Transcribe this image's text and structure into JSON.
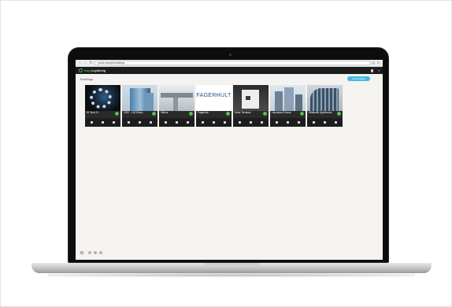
{
  "browser": {
    "url": "portal.example/buildings",
    "url_suffix": ""
  },
  "app": {
    "brand_prefix": "mapp",
    "brand_suffix": "Lightning",
    "user_name": "",
    "accent": "#4bb34f"
  },
  "page": {
    "title": "Buildings",
    "add_button": "Add building"
  },
  "cards": [
    {
      "name": "ID Tech 21",
      "sub": "",
      "photo": "p0"
    },
    {
      "name": "2020 - 100 Shad...",
      "sub": "",
      "photo": "p1"
    },
    {
      "name": "Vilnius",
      "sub": "",
      "photo": "p2"
    },
    {
      "name": "Fagerhult",
      "sub": "",
      "photo": "p3",
      "brand_text": "FAGERHULT"
    },
    {
      "name": "Duke Terraces",
      "sub": "",
      "photo": "p4"
    },
    {
      "name": "Lansdown House",
      "sub": "",
      "photo": "p5"
    },
    {
      "name": "Whitecliff Lighthouse",
      "sub": "",
      "photo": "p6"
    }
  ],
  "footer": {
    "text": ""
  }
}
